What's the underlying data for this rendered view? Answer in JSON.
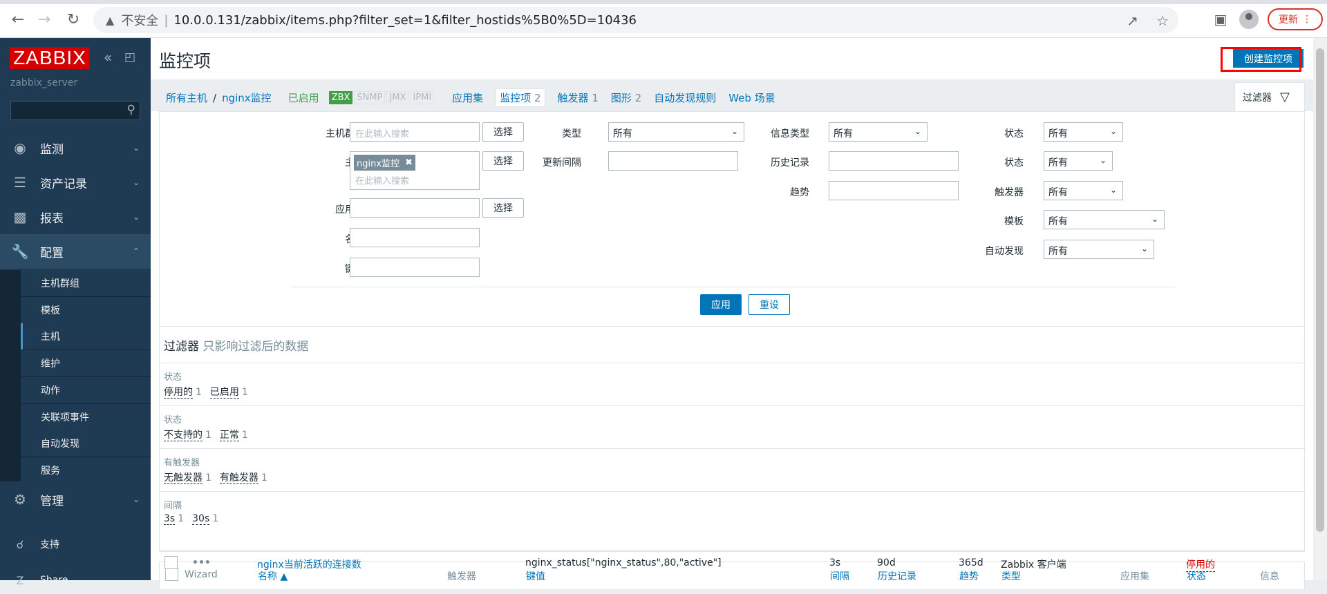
{
  "browser": {
    "insecure": "不安全",
    "url": "10.0.0.131/zabbix/items.php?filter_set=1&filter_hostids%5B0%5D=10436",
    "update": "更新"
  },
  "sidebar": {
    "logo": "ZABBIX",
    "server": "zabbix_server",
    "menu": [
      {
        "label": "监测"
      },
      {
        "label": "资产记录"
      },
      {
        "label": "报表"
      },
      {
        "label": "配置"
      },
      {
        "label": "管理"
      }
    ],
    "submenu": [
      "主机群组",
      "模板",
      "主机",
      "维护",
      "动作",
      "关联项事件",
      "自动发现",
      "服务"
    ],
    "support": "支持",
    "share": "Share"
  },
  "header": {
    "title": "监控项",
    "create_button": "创建监控项"
  },
  "breadcrumb": {
    "all_hosts": "所有主机",
    "host": "nginx监控",
    "enabled": "已启用",
    "badges": [
      "ZBX",
      "SNMP",
      "JMX",
      "IPMI"
    ],
    "apps": "应用集",
    "items": "监控项",
    "items_count": "2",
    "triggers": "触发器",
    "triggers_count": "1",
    "graphs": "图形",
    "graphs_count": "2",
    "discovery": "自动发现规则",
    "web": "Web 场景"
  },
  "filter": {
    "tab_label": "过滤器",
    "host_group_label": "主机群组",
    "search_placeholder": "在此输入搜索",
    "select": "选择",
    "host_label": "主机",
    "host_chip": "nginx监控",
    "application_label": "应用集",
    "name_label": "名称",
    "key_label": "键值",
    "type_label": "类型",
    "type_value": "所有",
    "interval_label": "更新间隔",
    "info_type_label": "信息类型",
    "info_type_value": "所有",
    "history_label": "历史记录",
    "trends_label": "趋势",
    "state_label": "状态",
    "state_value": "所有",
    "status_label": "状态",
    "status_value": "所有",
    "triggers_label": "触发器",
    "triggers_value": "所有",
    "template_label": "模板",
    "template_value": "所有",
    "discovery_label": "自动发现",
    "discovery_value": "所有",
    "apply": "应用",
    "reset": "重设"
  },
  "subfilter": {
    "title": "过滤器",
    "hint": "只影响过滤后的数据",
    "groups": [
      {
        "label": "状态",
        "values": [
          {
            "v": "停用的",
            "c": "1"
          },
          {
            "v": "已启用",
            "c": "1"
          }
        ]
      },
      {
        "label": "状态",
        "values": [
          {
            "v": "不支持的",
            "c": "1"
          },
          {
            "v": "正常",
            "c": "1"
          }
        ]
      },
      {
        "label": "有触发器",
        "values": [
          {
            "v": "无触发器",
            "c": "1"
          },
          {
            "v": "有触发器",
            "c": "1"
          }
        ]
      },
      {
        "label": "间隔",
        "values": [
          {
            "v": "3s",
            "c": "1"
          },
          {
            "v": "30s",
            "c": "1"
          }
        ]
      }
    ]
  },
  "table": {
    "headers": {
      "wizard": "Wizard",
      "name": "名称 ▲",
      "triggers": "触发器",
      "key": "键值",
      "interval": "间隔",
      "history": "历史记录",
      "trends": "趋势",
      "type": "类型",
      "applications": "应用集",
      "status": "状态",
      "info": "信息"
    },
    "rows": [
      {
        "name": "nginx当前活跃的连接数",
        "key": "nginx_status[\"nginx_status\",80,\"active\"]",
        "interval": "3s",
        "history": "90d",
        "trends": "365d",
        "type": "Zabbix 客户端",
        "status": "停用的"
      }
    ]
  }
}
